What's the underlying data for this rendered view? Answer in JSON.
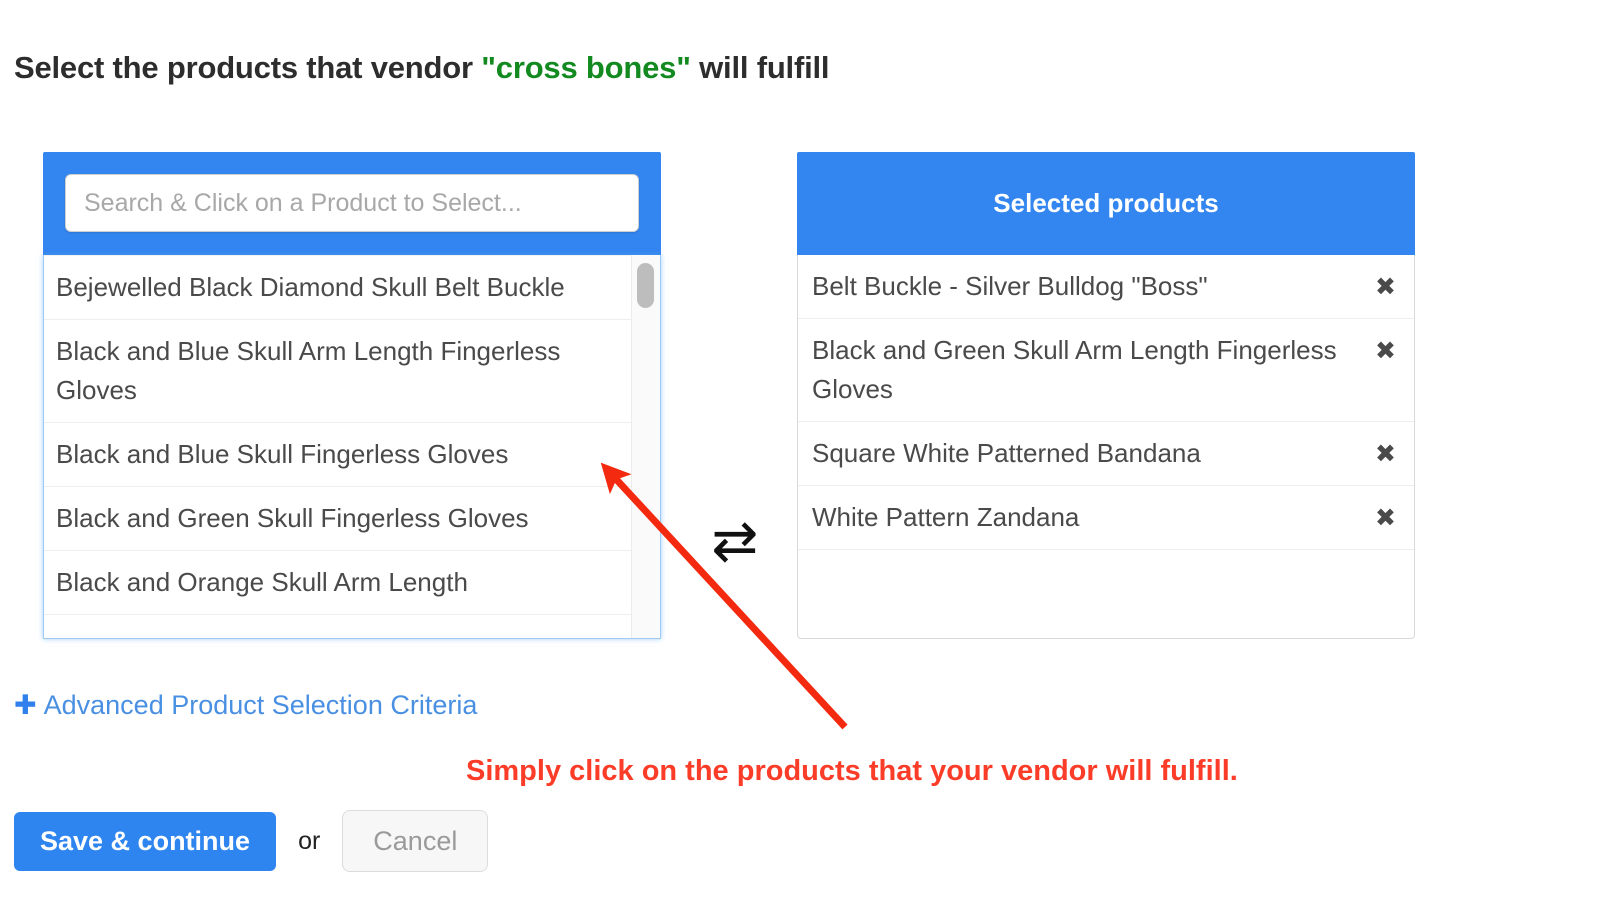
{
  "heading": {
    "prefix": "Select the products that vendor ",
    "vendor": "\"cross bones\"",
    "suffix": " will fulfill"
  },
  "available_panel": {
    "search_placeholder": "Search & Click on a Product to Select...",
    "items": [
      "Bejewelled Black Diamond Skull Belt Buckle",
      "Black and Blue Skull Arm Length Fingerless Gloves",
      "Black and Blue Skull Fingerless Gloves",
      "Black and Green Skull Fingerless Gloves",
      "Black and Orange Skull Arm Length"
    ]
  },
  "swap": {
    "icon": "⇄"
  },
  "selected_panel": {
    "title": "Selected products",
    "remove_icon": "✖",
    "items": [
      "Belt Buckle - Silver Bulldog \"Boss\"",
      "Black and Green Skull Arm Length Fingerless Gloves",
      "Square White Patterned Bandana",
      "White Pattern Zandana"
    ]
  },
  "advanced": {
    "plus_icon": "✚",
    "label": "Advanced Product Selection Criteria"
  },
  "annotation": {
    "text": "Simply click on the products that your vendor will fulfill.",
    "color": "#fa3c28"
  },
  "footer": {
    "save_label": "Save & continue",
    "or_label": "or",
    "cancel_label": "Cancel"
  },
  "colors": {
    "accent_blue": "#3385f0",
    "vendor_green": "#128a20",
    "annotation_red": "#fa3c28",
    "link_blue": "#4a90e2"
  }
}
